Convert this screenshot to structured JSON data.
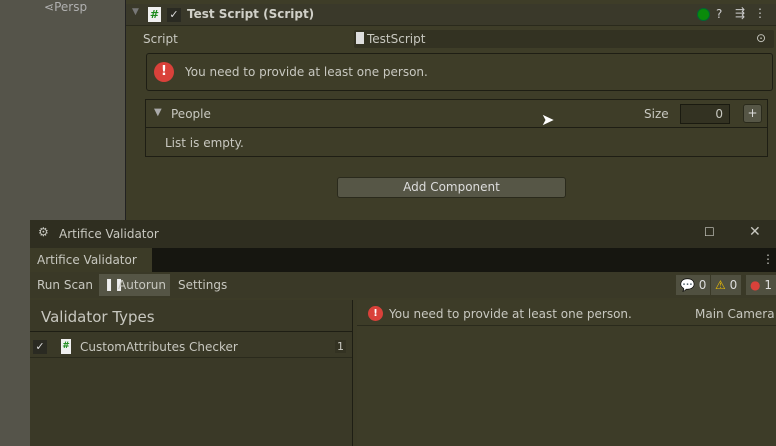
{
  "scene": {
    "persp_label": "Persp"
  },
  "inspector": {
    "component_title": "Test Script (Script)",
    "script_label": "Script",
    "script_value": "TestScript",
    "help_message": "You need to provide at least one person.",
    "list": {
      "label": "People",
      "size_label": "Size",
      "size_value": "0",
      "add": "+",
      "empty_text": "List is empty."
    },
    "add_component": "Add Component",
    "colors": {
      "status_green": "#0a8a0a",
      "error": "#d9413a"
    }
  },
  "validator": {
    "window_title": "Artifice Validator",
    "tab_label": "Artifice Validator",
    "toolbar": {
      "run_scan": "Run Scan",
      "autorun": "Autorun",
      "settings": "Settings"
    },
    "badges": {
      "info": "0",
      "warning": "0",
      "error": "1"
    },
    "types_header": "Validator Types",
    "types": [
      {
        "name": "CustomAttributes Checker",
        "count": "1",
        "checked": true
      }
    ],
    "logs": [
      {
        "message": "You need to provide at least one person.",
        "source": "Main Camera"
      }
    ]
  }
}
